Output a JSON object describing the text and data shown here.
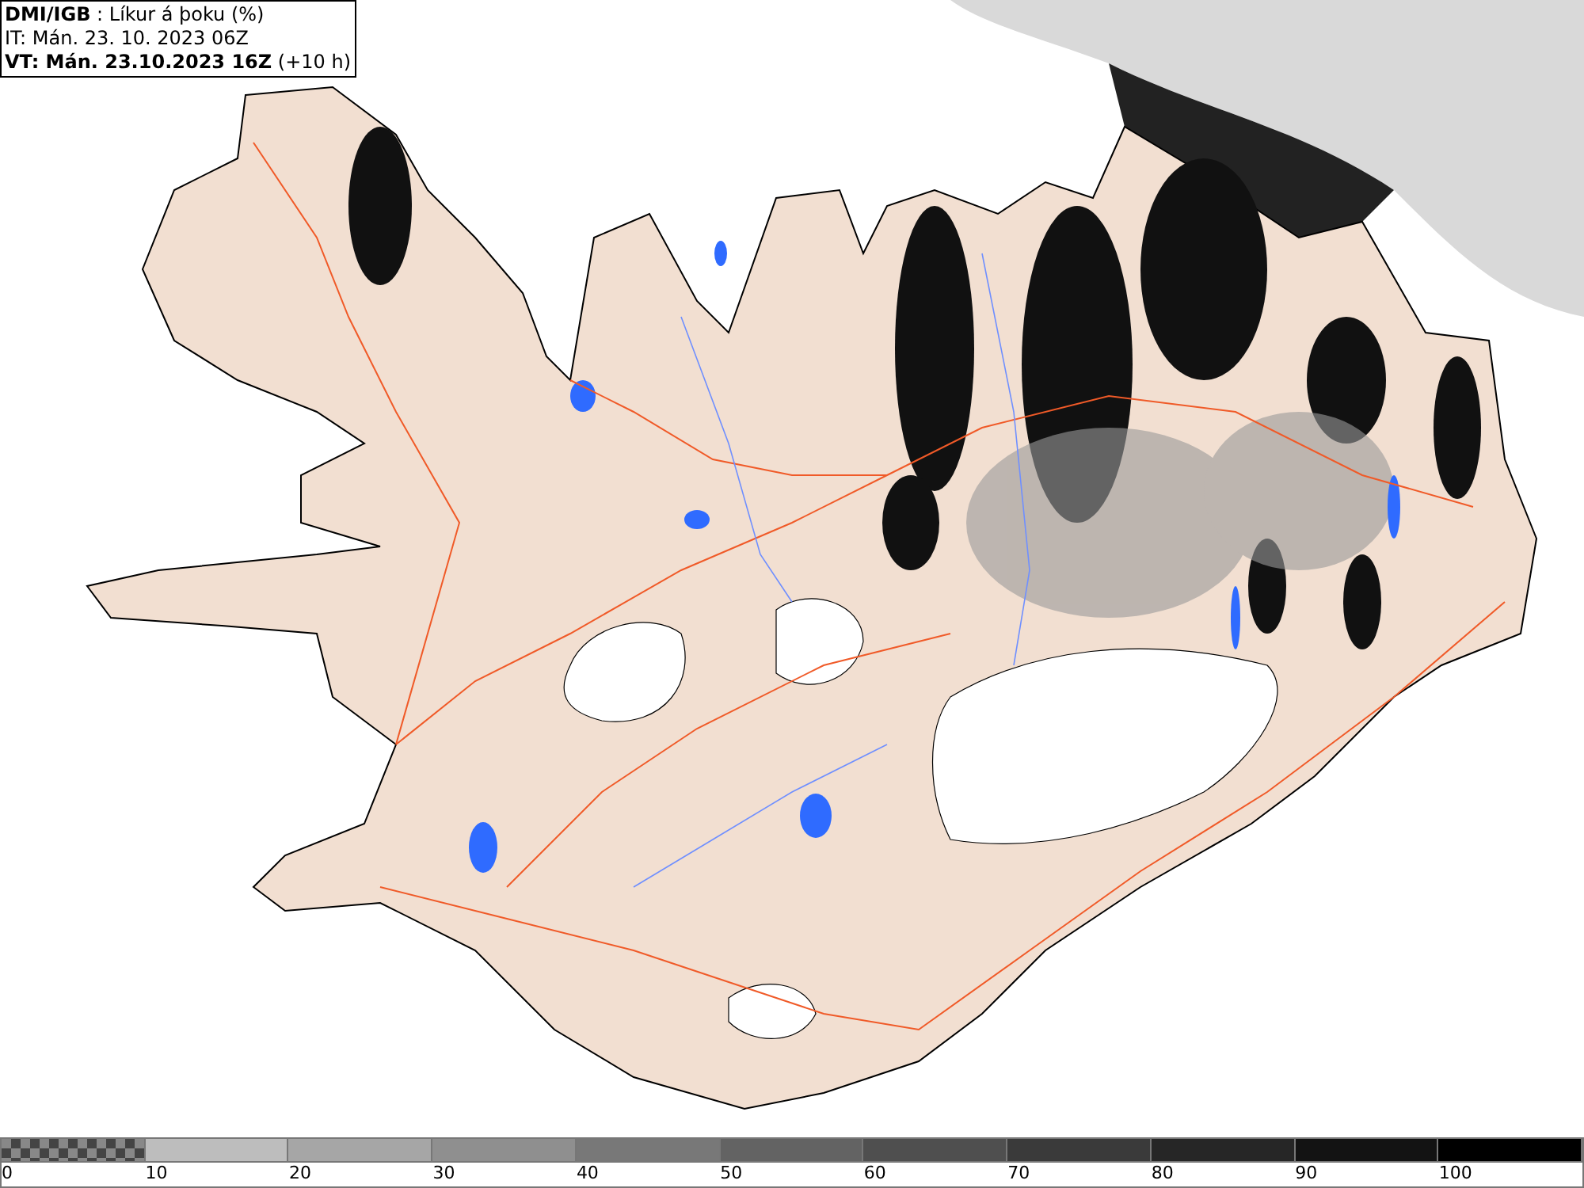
{
  "info": {
    "title": "**DMI/IGB** : Líkur á þoku (%)",
    "issue_time": "IT: Mán. 23. 10. 2023 06Z",
    "valid_time": "**VT: Mán. 23.10.2023 16Z** (+10 h)"
  },
  "legend": {
    "segments": [
      {
        "kind": "checker"
      },
      {
        "kind": "solid",
        "color": "#bdbdbd"
      },
      {
        "kind": "solid",
        "color": "#a6a6a6"
      },
      {
        "kind": "solid",
        "color": "#8f8f8f"
      },
      {
        "kind": "solid",
        "color": "#787878"
      },
      {
        "kind": "solid",
        "color": "#636363"
      },
      {
        "kind": "solid",
        "color": "#4f4f4f"
      },
      {
        "kind": "solid",
        "color": "#3a3a3a"
      },
      {
        "kind": "solid",
        "color": "#262626"
      },
      {
        "kind": "solid",
        "color": "#131313"
      },
      {
        "kind": "solid",
        "color": "#000000"
      }
    ],
    "labels": [
      "0",
      "10",
      "20",
      "30",
      "40",
      "50",
      "60",
      "70",
      "80",
      "90",
      "100"
    ]
  }
}
